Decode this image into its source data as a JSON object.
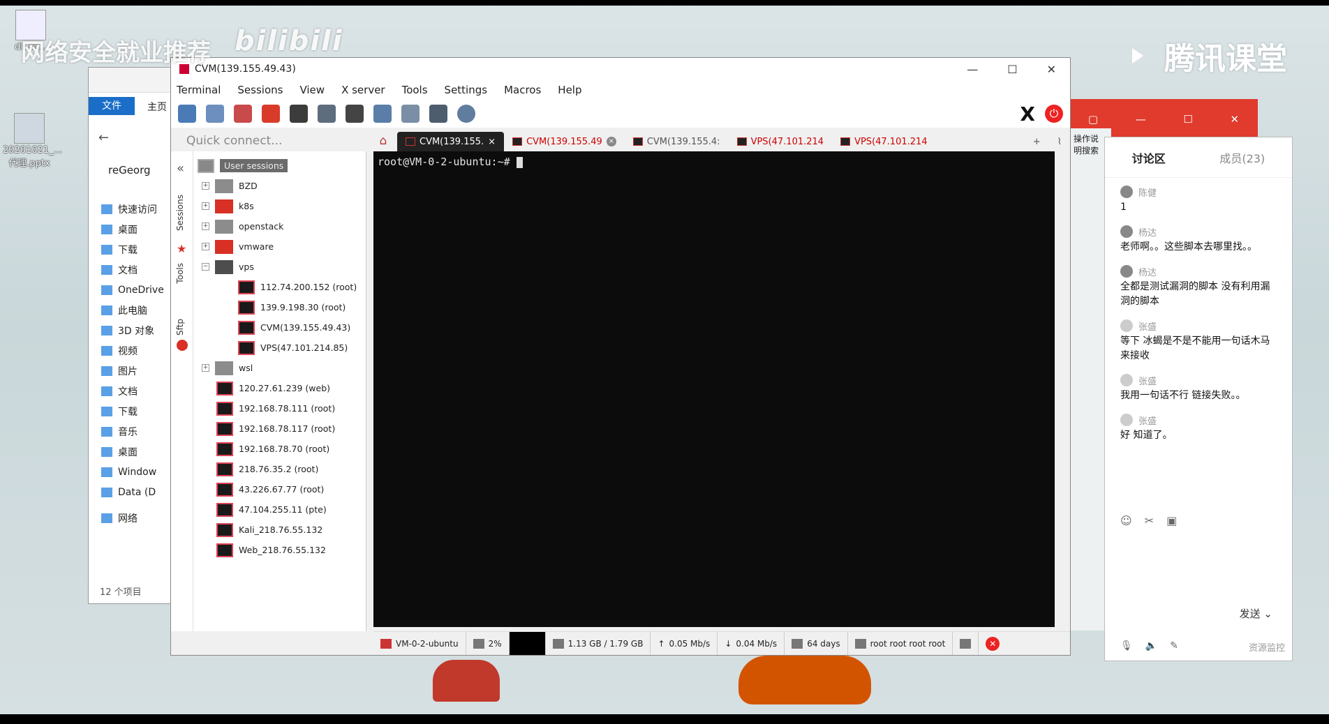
{
  "overlay": {
    "watermark_left": "网络安全就业推荐",
    "watermark_bili": "bilibili",
    "watermark_right": "腾讯课堂"
  },
  "desktop": {
    "icons": [
      {
        "label": "dli.sc...",
        "icon": "file-icon"
      },
      {
        "label": "20201021_... 代理.pptx",
        "icon": "pptx-icon"
      }
    ]
  },
  "explorer": {
    "tab_file": "文件",
    "tab_home": "主页",
    "user_folder": "reGeorg",
    "nav_items": [
      "快速访问",
      "桌面",
      "下载",
      "文档",
      "OneDrive",
      "此电脑",
      "3D 对象",
      "视频",
      "图片",
      "文档",
      "下载",
      "音乐",
      "桌面",
      "Window",
      "Data (D",
      "网络"
    ],
    "footer": "12 个项目"
  },
  "moba": {
    "title": "CVM(139.155.49.43)",
    "menu": [
      "Terminal",
      "Sessions",
      "View",
      "X server",
      "Tools",
      "Settings",
      "Macros",
      "Help"
    ],
    "quick_connect_placeholder": "Quick connect...",
    "tabs": [
      {
        "label": "CVM(139.155.",
        "active": true
      },
      {
        "label": "CVM(139.155.49",
        "active": false
      },
      {
        "label": "CVM(139.155.4:",
        "active": false
      },
      {
        "label": "VPS(47.101.214",
        "active": false
      },
      {
        "label": "VPS(47.101.214",
        "active": false
      }
    ],
    "side_tabs": [
      "Sessions",
      "Tools",
      "Sftp"
    ],
    "tree": {
      "root": "User sessions",
      "folders_top": [
        "BZD",
        "k8s",
        "openstack",
        "vmware",
        "vps"
      ],
      "vps_children": [
        "112.74.200.152 (root)",
        "139.9.198.30 (root)",
        "CVM(139.155.49.43)",
        "VPS(47.101.214.85)"
      ],
      "folder_wsl": "wsl",
      "sessions": [
        "120.27.61.239 (web)",
        "192.168.78.111 (root)",
        "192.168.78.117 (root)",
        "192.168.78.70 (root)",
        "218.76.35.2 (root)",
        "43.226.67.77 (root)",
        "47.104.255.11 (pte)",
        "Kali_218.76.55.132",
        "Web_218.76.55.132"
      ]
    },
    "terminal_prompt": "root@VM-0-2-ubuntu:~# ",
    "status": {
      "host": "VM-0-2-ubuntu",
      "cpu": "2%",
      "mem": "1.13 GB / 1.79 GB",
      "up": "0.05 Mb/s",
      "down": "0.04 Mb/s",
      "uptime": "64 days",
      "users": "root  root  root  root"
    }
  },
  "chat": {
    "tab_discussion": "讨论区",
    "tab_members": "成员(23)",
    "messages": [
      {
        "user": "陈健",
        "text": "1"
      },
      {
        "user": "杨达",
        "text": "老师啊。。这些脚本去哪里找。。"
      },
      {
        "user": "杨达",
        "text": "全都是测试漏洞的脚本 没有利用漏洞的脚本"
      },
      {
        "user": "张盛",
        "text": "等下 冰蝎是不是不能用一句话木马来接收"
      },
      {
        "user": "张盛",
        "text": "我用一句话不行 链接失败。。"
      },
      {
        "user": "张盛",
        "text": "好 知道了。"
      }
    ],
    "send_label": "发送",
    "resource_monitor": "资源监控"
  },
  "redwin": {
    "subtitle": "操作说明搜索"
  }
}
